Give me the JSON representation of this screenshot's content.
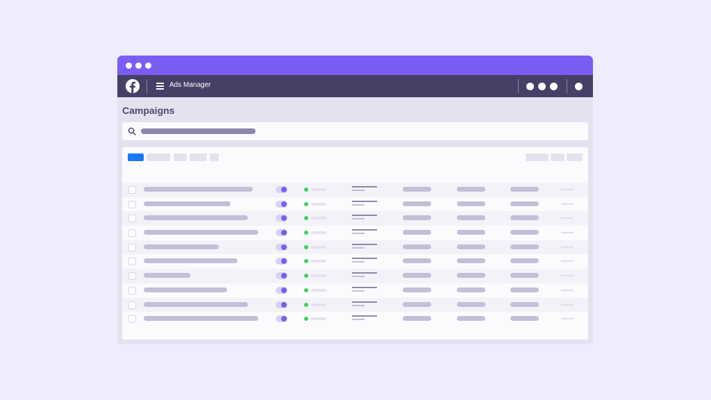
{
  "window": {
    "title_bar_color": "#7b5cf5",
    "nav_color": "#474066"
  },
  "navbar": {
    "logo_icon": "facebook-logo-icon",
    "menu_icon": "hamburger-menu-icon",
    "app_title": "Ads Manager"
  },
  "page": {
    "title": "Campaigns",
    "search_icon": "search-icon"
  },
  "toolbar": {
    "primary_button_color": "#1877f2"
  },
  "table": {
    "row_count": 10,
    "status_color": "#3ecf5d",
    "toggle_color": "#7b5cf5",
    "toggle_state": "on"
  }
}
